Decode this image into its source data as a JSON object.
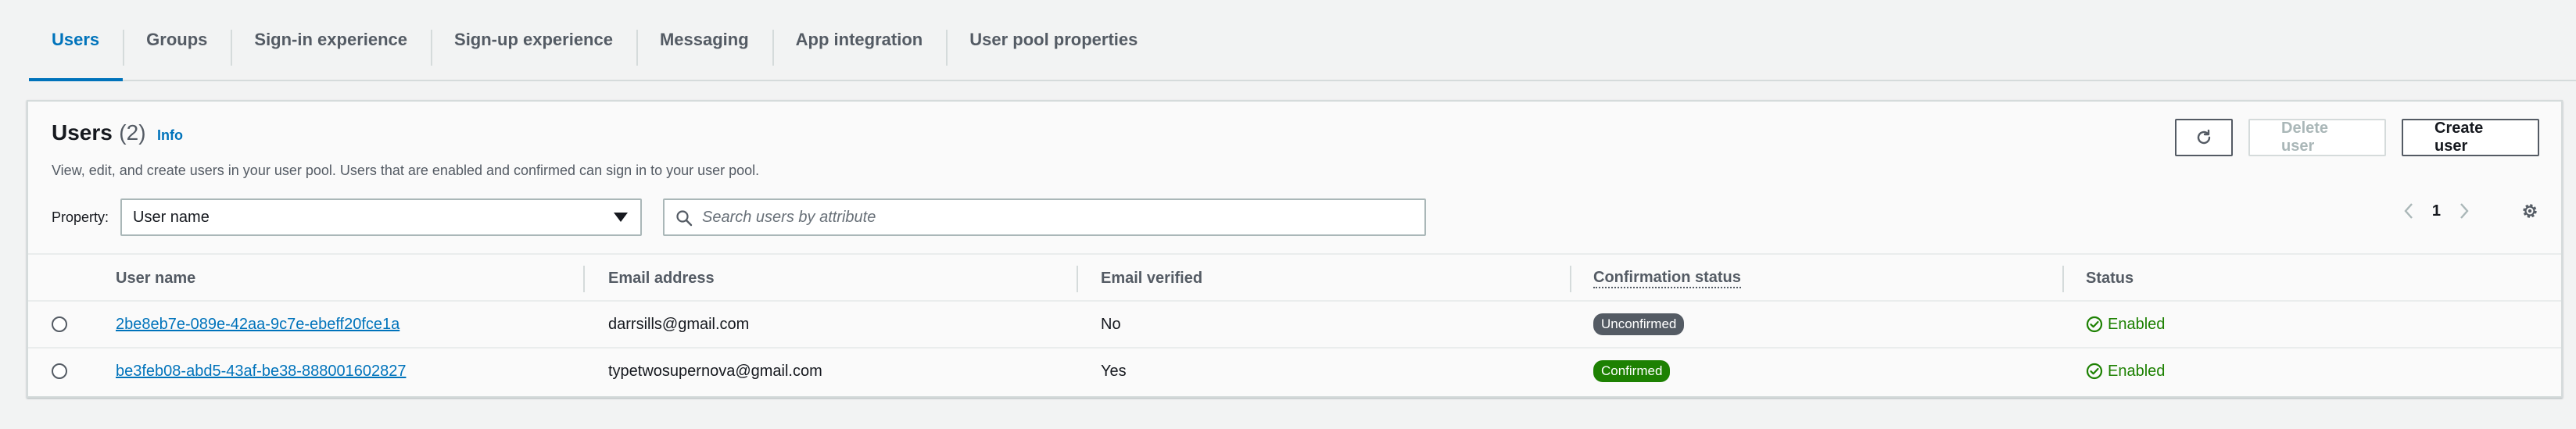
{
  "tabs": [
    {
      "label": "Users",
      "active": true
    },
    {
      "label": "Groups"
    },
    {
      "label": "Sign-in experience"
    },
    {
      "label": "Sign-up experience"
    },
    {
      "label": "Messaging"
    },
    {
      "label": "App integration"
    },
    {
      "label": "User pool properties"
    }
  ],
  "panel": {
    "title": "Users",
    "count": "(2)",
    "info": "Info",
    "description": "View, edit, and create users in your user pool. Users that are enabled and confirmed can sign in to your user pool.",
    "refresh_icon": "refresh-icon",
    "delete_label": "Delete user",
    "create_label": "Create user"
  },
  "filter": {
    "property_label": "Property:",
    "property_value": "User name",
    "search_placeholder": "Search users by attribute"
  },
  "pagination": {
    "current_page": "1"
  },
  "table": {
    "columns": [
      "User name",
      "Email address",
      "Email verified",
      "Confirmation status",
      "Status"
    ],
    "rows": [
      {
        "user_name": "2be8eb7e-089e-42aa-9c7e-ebeff20fce1a",
        "email": "darrsills@gmail.com",
        "email_verified": "No",
        "confirmation_status": "Unconfirmed",
        "status": "Enabled"
      },
      {
        "user_name": "be3feb08-abd5-43af-be38-888001602827",
        "email": "typetwosupernova@gmail.com",
        "email_verified": "Yes",
        "confirmation_status": "Confirmed",
        "status": "Enabled"
      }
    ]
  },
  "colors": {
    "accent": "#0073bb",
    "success": "#1d8102",
    "neutral_badge": "#545b64"
  }
}
